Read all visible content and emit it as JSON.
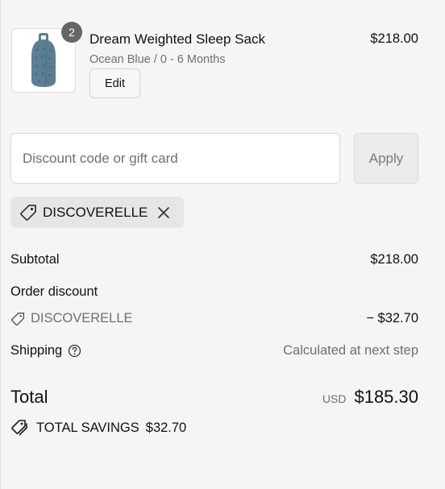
{
  "product": {
    "quantity": "2",
    "name": "Dream Weighted Sleep Sack",
    "variant": "Ocean Blue / 0 - 6 Months",
    "edit_label": "Edit",
    "price": "$218.00"
  },
  "discount": {
    "placeholder": "Discount code or gift card",
    "apply_label": "Apply",
    "applied_code": "DISCOVERELLE"
  },
  "summary": {
    "subtotal_label": "Subtotal",
    "subtotal_value": "$218.00",
    "order_discount_label": "Order discount",
    "discount_code": "DISCOVERELLE",
    "discount_value": "− $32.70",
    "shipping_label": "Shipping",
    "shipping_value": "Calculated at next step",
    "total_label": "Total",
    "currency": "USD",
    "total_value": "$185.30",
    "savings_label": "TOTAL SAVINGS",
    "savings_value": "$32.70"
  },
  "icons": {
    "tag": "tag-icon",
    "close": "close-icon",
    "help": "help-circle-icon",
    "savings": "savings-tags-icon"
  },
  "colors": {
    "background": "#f5f5f5",
    "badge": "#666666",
    "muted_text": "#707070",
    "chip_bg": "#e6e6e6",
    "product_blue": "#5a7f92"
  }
}
